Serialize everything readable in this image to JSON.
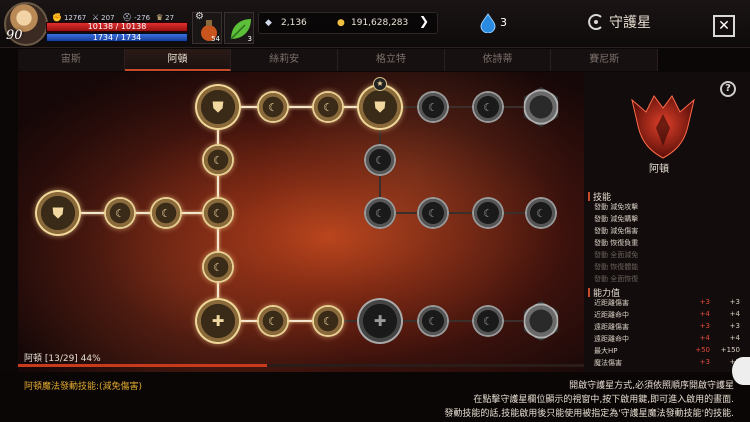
{
  "player": {
    "level": "90",
    "stats": [
      {
        "icon": "fist-icon",
        "value": "12767"
      },
      {
        "icon": "sword-icon",
        "value": "207"
      },
      {
        "icon": "helmet-icon",
        "value": "-276"
      },
      {
        "icon": "trophy-icon",
        "value": "27"
      }
    ],
    "hp_text": "10138 / 10138",
    "hp_fraction": 1.0,
    "mp_text": "1734 / 1734",
    "mp_fraction": 1.0
  },
  "slots": [
    {
      "icon": "potion-icon",
      "count": "54"
    },
    {
      "icon": "leaf-icon",
      "count": "3"
    }
  ],
  "currency": {
    "silver": "2,136",
    "gold": "191,628,283",
    "gem": "3"
  },
  "window": {
    "title": "守護星",
    "close_label": "✕"
  },
  "tabs": [
    "宙斯",
    "阿頓",
    "絲莉安",
    "格立特",
    "依詩蒂",
    "賽尼斯"
  ],
  "active_tab": 1,
  "progress": {
    "label": "阿頓 [13/29] 44%",
    "fraction": 0.44
  },
  "panel": {
    "help": "?",
    "constellation_name": "阿頓",
    "skills_title": "技能",
    "skills": [
      {
        "text": "發動 減免攻擊",
        "active": true
      },
      {
        "text": "發動 減免購擊",
        "active": true
      },
      {
        "text": "發動 減免傷害",
        "active": true
      },
      {
        "text": "發動 恢復負重",
        "active": true
      },
      {
        "text": "發動 全面減免",
        "active": false
      },
      {
        "text": "發動 恢復體能",
        "active": false
      },
      {
        "text": "發動 全面恢復",
        "active": false
      }
    ],
    "stats_title": "能力值",
    "stats": [
      {
        "name": "近距離傷害",
        "current": "+3",
        "total": "+3"
      },
      {
        "name": "近距離命中",
        "current": "+4",
        "total": "+4"
      },
      {
        "name": "遠距離傷害",
        "current": "+3",
        "total": "+3"
      },
      {
        "name": "遠距離命中",
        "current": "+4",
        "total": "+4"
      },
      {
        "name": "最大HP",
        "current": "+50",
        "total": "+150"
      },
      {
        "name": "魔法傷害",
        "current": "+3",
        "total": "+3"
      }
    ]
  },
  "bottom": {
    "selected_skill": "阿頓魔法發動技能:(減免傷害)",
    "info_lines": [
      "開啟守護星方式,必須依照順序開啟守護星",
      "在點擊守護星欄位顯示的視窗中,按下啟用鍵,即可進入啟用的畫面.",
      "發動技能的話,技能啟用後只能使用被指定為'守護星魔法發動技能'的技能."
    ]
  }
}
